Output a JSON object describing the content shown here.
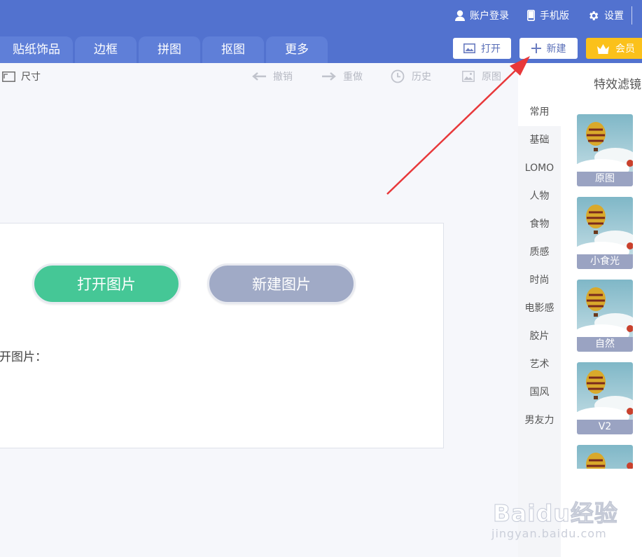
{
  "header": {
    "top_links": [
      {
        "label": "账户登录",
        "icon": "user-icon"
      },
      {
        "label": "手机版",
        "icon": "phone-icon"
      },
      {
        "label": "设置",
        "icon": "gear-icon"
      }
    ],
    "tabs": [
      "贴纸饰品",
      "边框",
      "拼图",
      "抠图",
      "更多"
    ],
    "buttons": {
      "open": "打开",
      "new": "新建",
      "vip": "会员"
    },
    "colors": {
      "header_bg": "#5272cf",
      "tab_bg": "#5f7fd8",
      "vip": "#fbc11b"
    }
  },
  "toolbar": {
    "size": "尺寸",
    "undo": "撤销",
    "redo": "重做",
    "history": "历史",
    "original": "原图"
  },
  "canvas": {
    "open_image": "打开图片",
    "new_image": "新建图片",
    "recent_label": "开图片：",
    "colors": {
      "open": "#45c796",
      "new": "#a0aac6"
    }
  },
  "filters": {
    "title": "特效滤镜",
    "categories": [
      "常用",
      "基础",
      "LOMO",
      "人物",
      "食物",
      "质感",
      "时尚",
      "电影感",
      "胶片",
      "艺术",
      "国风",
      "男友力"
    ],
    "active_category": "常用",
    "thumbnails": [
      "原图",
      "小食光",
      "自然",
      "V2",
      ""
    ]
  },
  "watermark": {
    "main": "Baidu经验",
    "sub": "jingyan.baidu.com"
  }
}
